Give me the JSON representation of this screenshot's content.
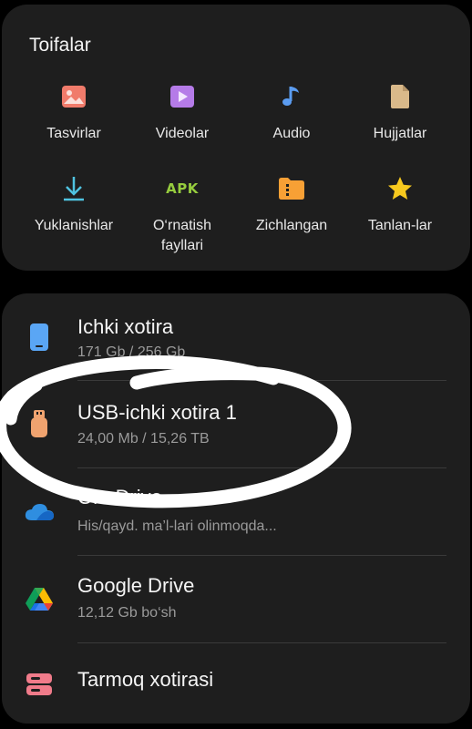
{
  "categories": {
    "title": "Toifalar",
    "items": [
      {
        "label": "Tasvirlar",
        "icon": "image-icon",
        "color": "#f07b6b"
      },
      {
        "label": "Videolar",
        "icon": "video-play-icon",
        "color": "#b57be8"
      },
      {
        "label": "Audio",
        "icon": "music-note-icon",
        "color": "#5b9cf0"
      },
      {
        "label": "Hujjatlar",
        "icon": "document-icon",
        "color": "#d9b98a"
      },
      {
        "label": "Yuklanishlar",
        "icon": "download-icon",
        "color": "#4fc3e0"
      },
      {
        "label": "O‘rnatish fayllari",
        "icon_text": "APK",
        "icon": "apk-icon",
        "color": "#96cc3e"
      },
      {
        "label": "Zichlangan",
        "icon": "archive-folder-icon",
        "color": "#f7a035"
      },
      {
        "label": "Tanlan-lar",
        "icon": "star-icon",
        "color": "#f7c91e"
      }
    ]
  },
  "storage": {
    "items": [
      {
        "title": "Ichki xotira",
        "subtitle": "171 Gb / 256 Gb",
        "icon": "phone-storage-icon",
        "color": "#5aa6f5"
      },
      {
        "title": "USB-ichki xotira 1",
        "subtitle": "24,00 Mb / 15,26 TB",
        "icon": "usb-drive-icon",
        "color": "#f0a36f"
      },
      {
        "title": "OneDrive",
        "subtitle": "His/qayd. ma’l-lari olinmoqda...",
        "icon": "onedrive-cloud-icon",
        "color": "#2f8ee0"
      },
      {
        "title": "Google Drive",
        "subtitle": "12,12 Gb bo‘sh",
        "icon": "google-drive-icon",
        "color": "#34a853"
      },
      {
        "title": "Tarmoq xotirasi",
        "subtitle": "",
        "icon": "network-storage-icon",
        "color": "#f07b8a"
      }
    ]
  }
}
